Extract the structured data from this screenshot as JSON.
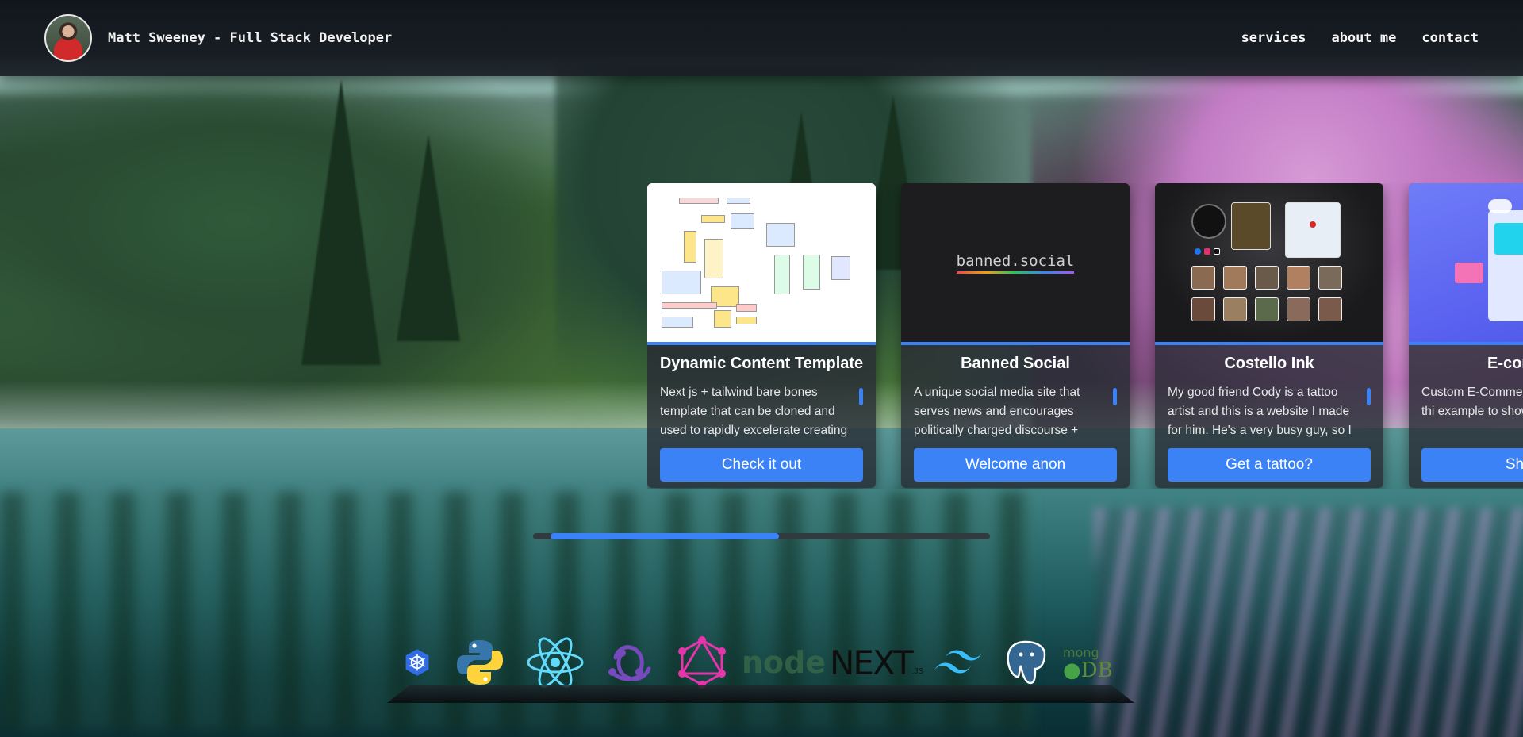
{
  "header": {
    "title": "Matt Sweeney - Full Stack Developer",
    "nav": [
      {
        "label": "services"
      },
      {
        "label": "about me"
      },
      {
        "label": "contact"
      }
    ]
  },
  "projects": [
    {
      "title": "Dynamic Content Template",
      "description": "Next js + tailwind bare bones template that can be cloned and used to rapidly excelerate creating",
      "button": "Check it out"
    },
    {
      "title": "Banned Social",
      "image_text": "banned.social",
      "description": "A unique social media site that serves news and encourages politically charged discourse +",
      "button": "Welcome anon"
    },
    {
      "title": "Costello Ink",
      "description": "My good friend Cody is a tattoo artist and this is a website I made for him. He's a very busy guy, so I",
      "button": "Get a tattoo?"
    },
    {
      "title": "E-comme",
      "description": "Custom E-Comme design. I made thi example to showc",
      "button": "Shop"
    }
  ],
  "carousel": {
    "progress": 0.5
  },
  "tech_stack": [
    {
      "icon": "kubernetes-icon"
    },
    {
      "icon": "python-icon"
    },
    {
      "icon": "react-icon"
    },
    {
      "icon": "redux-icon"
    },
    {
      "icon": "graphql-icon"
    },
    {
      "icon": "nodejs-icon",
      "text": "node"
    },
    {
      "icon": "nextjs-icon",
      "text": "NEXT",
      "subtext": ".JS"
    },
    {
      "icon": "tailwind-icon"
    },
    {
      "icon": "postgresql-icon"
    },
    {
      "icon": "mongodb-icon",
      "text": "mong",
      "subtext": "DB"
    }
  ],
  "colors": {
    "accent": "#3b82f6",
    "header_bg": "#181d24",
    "card_bg": "#282c34"
  }
}
